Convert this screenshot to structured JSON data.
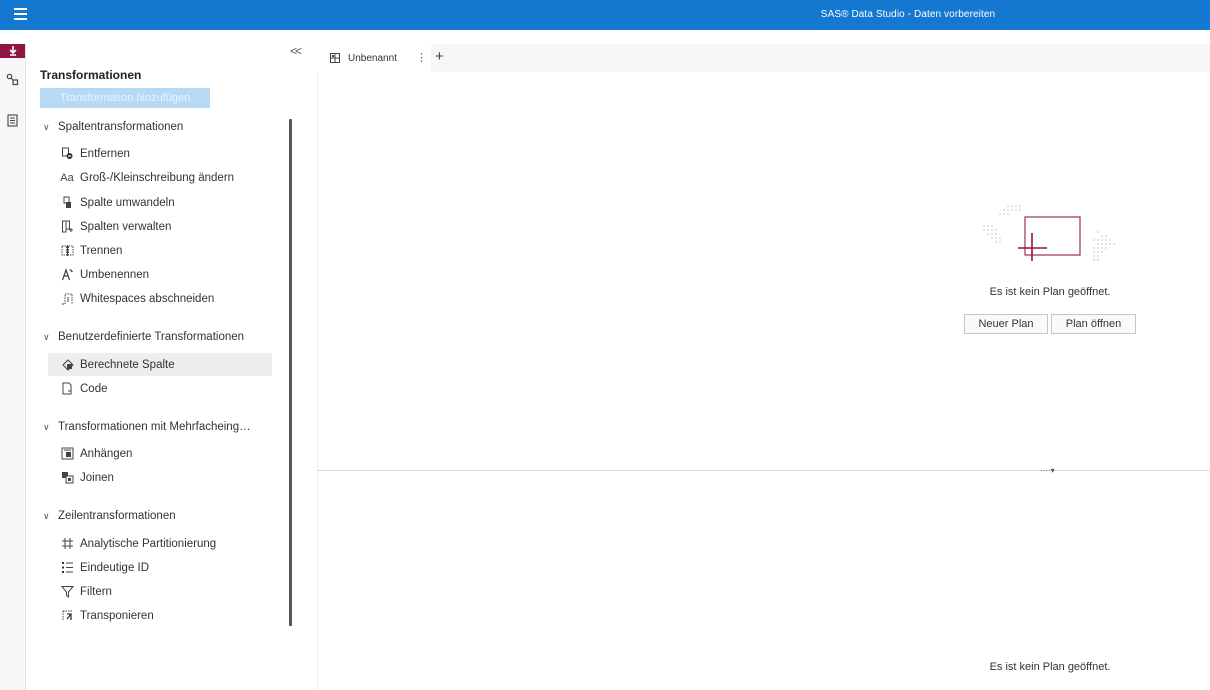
{
  "header": {
    "app_title": "SAS® Data Studio - Daten vorbereiten",
    "menu_icon": "hamburger-menu-icon"
  },
  "rail": {
    "items": [
      "transform-icon",
      "connections-icon",
      "details-icon"
    ],
    "active_color": "#8e1544"
  },
  "panel": {
    "title": "Transformationen",
    "add_button": "Transformation hinzufügen",
    "collapse_label": "<<",
    "groups": [
      {
        "label": "Spaltentransformationen",
        "items": [
          {
            "label": "Entfernen",
            "icon": "remove-column-icon"
          },
          {
            "label": "Groß-/Kleinschreibung ändern",
            "icon": "text-case-icon",
            "glyph": "Aa"
          },
          {
            "label": "Spalte umwandeln",
            "icon": "convert-column-icon"
          },
          {
            "label": "Spalten verwalten",
            "icon": "manage-columns-icon"
          },
          {
            "label": "Trennen",
            "icon": "split-icon"
          },
          {
            "label": "Umbenennen",
            "icon": "rename-icon"
          },
          {
            "label": "Whitespaces abschneiden",
            "icon": "trim-whitespace-icon"
          }
        ]
      },
      {
        "label": "Benutzerdefinierte Transformationen",
        "items": [
          {
            "label": "Berechnete Spalte",
            "icon": "calculated-column-icon",
            "selected": true
          },
          {
            "label": "Code",
            "icon": "code-icon"
          }
        ]
      },
      {
        "label": "Transformationen mit Mehrfacheing…",
        "items": [
          {
            "label": "Anhängen",
            "icon": "append-icon"
          },
          {
            "label": "Joinen",
            "icon": "join-icon"
          }
        ]
      },
      {
        "label": "Zeilentransformationen",
        "items": [
          {
            "label": "Analytische Partitionierung",
            "icon": "partition-icon"
          },
          {
            "label": "Eindeutige ID",
            "icon": "unique-id-icon"
          },
          {
            "label": "Filtern",
            "icon": "filter-icon"
          },
          {
            "label": "Transponieren",
            "icon": "transpose-icon"
          }
        ]
      }
    ]
  },
  "tabs": [
    {
      "label": "Unbenannt"
    }
  ],
  "tab_add": "+",
  "tab_menu": "⋮",
  "main": {
    "empty_message": "Es ist kein Plan geöffnet.",
    "new_plan": "Neuer Plan",
    "open_plan": "Plan öffnen",
    "bottom_message": "Es ist kein Plan geöffnet.",
    "splitter_glyph": "····▾"
  },
  "colors": {
    "header": "#1578d0",
    "accent": "#8e1544",
    "add_button_disabled": "#b8d9f3"
  }
}
